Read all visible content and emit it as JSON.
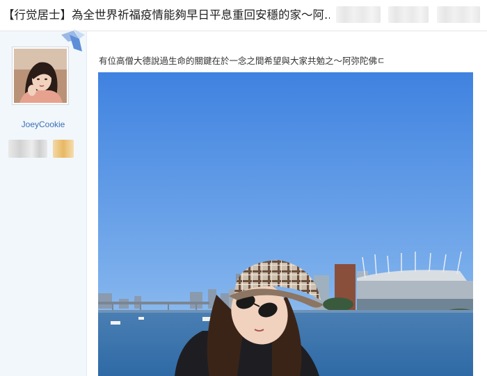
{
  "header": {
    "title": "【行觉居士】為全世界祈福疫情能夠早日平息重回安穩的家～阿..."
  },
  "sidebar": {
    "username": "JoeyCookie"
  },
  "post": {
    "text": "有位高僧大德說過生命的關鍵在於一念之間希望與大家共勉之～阿弥陀佛ㄷ"
  },
  "colors": {
    "link": "#3a6fb5",
    "sidebar_bg": "#f2f7fc",
    "sky_top": "#3f82e0",
    "sky_bottom": "#a9ccf0",
    "water": "#3f76b0"
  },
  "icons": [
    "avatar",
    "post-corner-ribbon"
  ]
}
